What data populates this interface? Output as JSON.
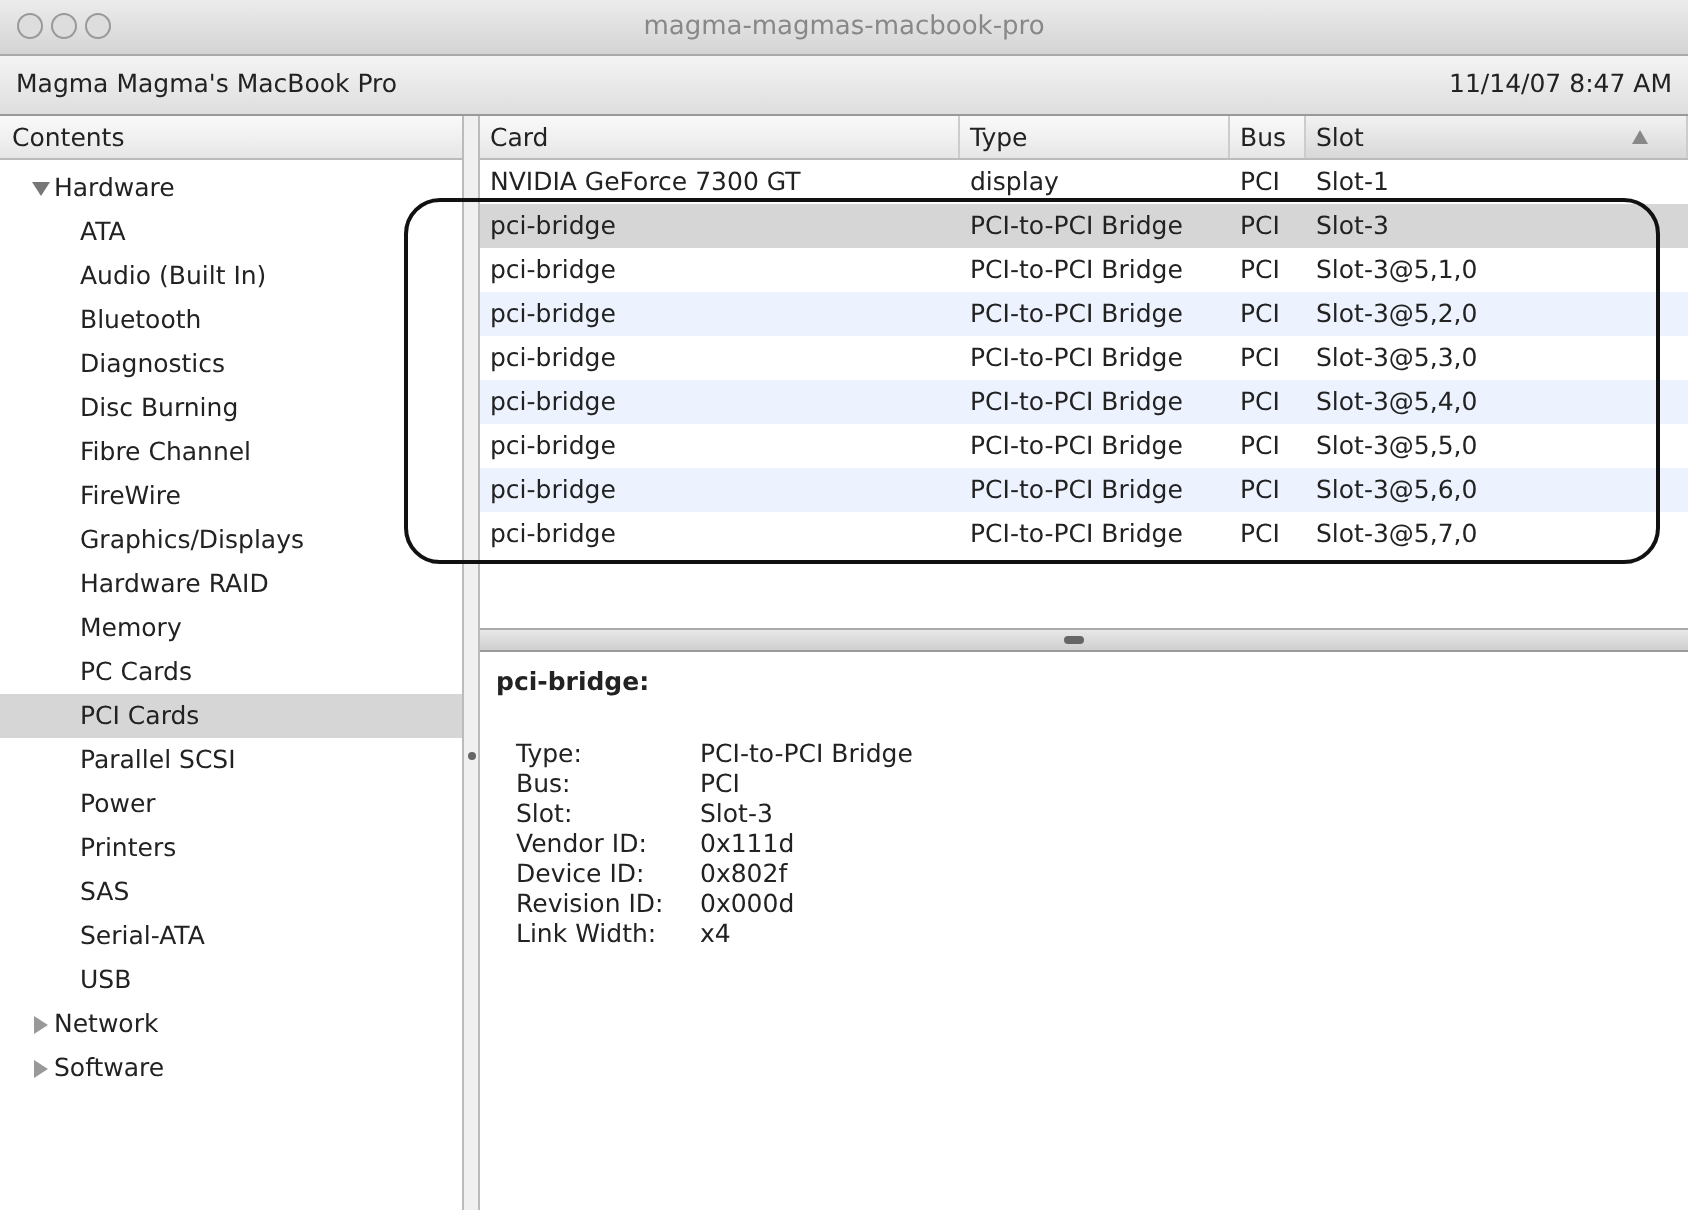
{
  "window": {
    "title": "magma-magmas-macbook-pro"
  },
  "header": {
    "computer": "Magma Magma's MacBook Pro",
    "date": "11/14/07 8:47 AM"
  },
  "sidebar": {
    "heading": "Contents",
    "items": [
      {
        "label": "Hardware",
        "expanded": true,
        "selected": false,
        "children": [
          {
            "label": "ATA",
            "selected": false
          },
          {
            "label": "Audio (Built In)",
            "selected": false
          },
          {
            "label": "Bluetooth",
            "selected": false
          },
          {
            "label": "Diagnostics",
            "selected": false
          },
          {
            "label": "Disc Burning",
            "selected": false
          },
          {
            "label": "Fibre Channel",
            "selected": false
          },
          {
            "label": "FireWire",
            "selected": false
          },
          {
            "label": "Graphics/Displays",
            "selected": false
          },
          {
            "label": "Hardware RAID",
            "selected": false
          },
          {
            "label": "Memory",
            "selected": false
          },
          {
            "label": "PC Cards",
            "selected": false
          },
          {
            "label": "PCI Cards",
            "selected": true
          },
          {
            "label": "Parallel SCSI",
            "selected": false
          },
          {
            "label": "Power",
            "selected": false
          },
          {
            "label": "Printers",
            "selected": false
          },
          {
            "label": "SAS",
            "selected": false
          },
          {
            "label": "Serial-ATA",
            "selected": false
          },
          {
            "label": "USB",
            "selected": false
          }
        ]
      },
      {
        "label": "Network",
        "expanded": false,
        "selected": false
      },
      {
        "label": "Software",
        "expanded": false,
        "selected": false
      }
    ]
  },
  "table": {
    "columns": [
      {
        "label": "Card",
        "sorted": false
      },
      {
        "label": "Type",
        "sorted": false
      },
      {
        "label": "Bus",
        "sorted": false
      },
      {
        "label": "Slot",
        "sorted": true
      }
    ],
    "rows": [
      {
        "cells": [
          "NVIDIA GeForce 7300 GT",
          "display",
          "PCI",
          "Slot-1"
        ],
        "selected": false
      }
    ],
    "outlined_rows": [
      {
        "cells": [
          "pci-bridge",
          "PCI-to-PCI Bridge",
          "PCI",
          "Slot-3"
        ],
        "selected": true
      },
      {
        "cells": [
          "pci-bridge",
          "PCI-to-PCI Bridge",
          "PCI",
          "Slot-3@5,1,0"
        ],
        "selected": false
      },
      {
        "cells": [
          "pci-bridge",
          "PCI-to-PCI Bridge",
          "PCI",
          "Slot-3@5,2,0"
        ],
        "selected": false
      },
      {
        "cells": [
          "pci-bridge",
          "PCI-to-PCI Bridge",
          "PCI",
          "Slot-3@5,3,0"
        ],
        "selected": false
      },
      {
        "cells": [
          "pci-bridge",
          "PCI-to-PCI Bridge",
          "PCI",
          "Slot-3@5,4,0"
        ],
        "selected": false
      },
      {
        "cells": [
          "pci-bridge",
          "PCI-to-PCI Bridge",
          "PCI",
          "Slot-3@5,5,0"
        ],
        "selected": false
      },
      {
        "cells": [
          "pci-bridge",
          "PCI-to-PCI Bridge",
          "PCI",
          "Slot-3@5,6,0"
        ],
        "selected": false
      },
      {
        "cells": [
          "pci-bridge",
          "PCI-to-PCI Bridge",
          "PCI",
          "Slot-3@5,7,0"
        ],
        "selected": false
      }
    ]
  },
  "detail": {
    "title": "pci-bridge:",
    "properties": [
      {
        "label": "Type:",
        "value": "PCI-to-PCI Bridge"
      },
      {
        "label": "Bus:",
        "value": "PCI"
      },
      {
        "label": "Slot:",
        "value": "Slot-3"
      },
      {
        "label": "Vendor ID:",
        "value": "0x111d"
      },
      {
        "label": "Device ID:",
        "value": "0x802f"
      },
      {
        "label": "Revision ID:",
        "value": "0x000d"
      },
      {
        "label": "Link Width:",
        "value": "x4"
      }
    ]
  }
}
